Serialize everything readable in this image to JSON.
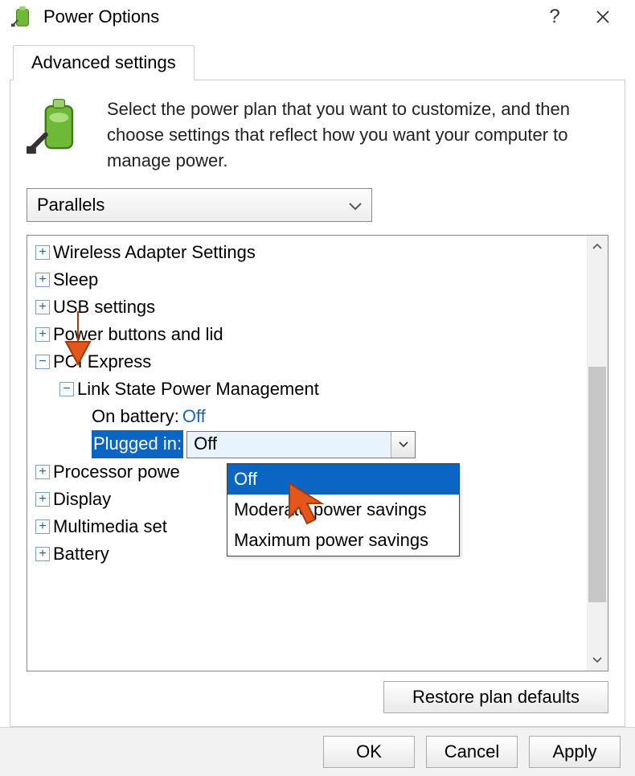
{
  "window": {
    "title": "Power Options"
  },
  "tab": {
    "label": "Advanced settings"
  },
  "intro": {
    "text": "Select the power plan that you want to customize, and then choose settings that reflect how you want your computer to manage power."
  },
  "plan": {
    "selected": "Parallels"
  },
  "tree": {
    "items": [
      {
        "label": "Wireless Adapter Settings",
        "expanded": false
      },
      {
        "label": "Sleep",
        "expanded": false
      },
      {
        "label": "USB settings",
        "expanded": false
      },
      {
        "label": "Power buttons and lid",
        "expanded": false
      },
      {
        "label": "PCI Express",
        "expanded": true
      },
      {
        "label": "Processor powe",
        "expanded": false
      },
      {
        "label": "Display",
        "expanded": false
      },
      {
        "label": "Multimedia set",
        "expanded": false
      },
      {
        "label": "Battery",
        "expanded": false
      }
    ],
    "pci_sub": {
      "label": "Link State Power Management"
    },
    "on_battery": {
      "label": "On battery:",
      "value": "Off"
    },
    "plugged_in": {
      "label": "Plugged in:",
      "value": "Off"
    }
  },
  "dropdown": {
    "options": [
      "Off",
      "Moderate power savings",
      "Maximum power savings"
    ],
    "selected": "Off"
  },
  "buttons": {
    "restore": "Restore plan defaults",
    "ok": "OK",
    "cancel": "Cancel",
    "apply": "Apply"
  }
}
